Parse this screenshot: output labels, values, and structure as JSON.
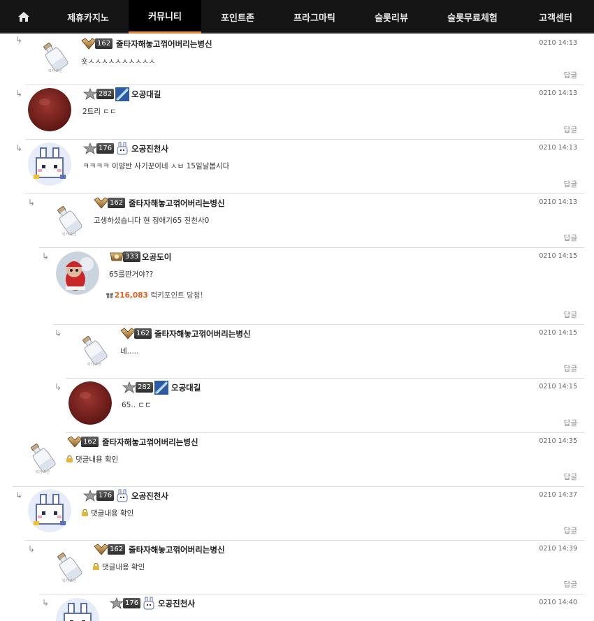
{
  "nav": {
    "home_icon": "home-icon",
    "items": [
      "제휴카지노",
      "커뮤니티",
      "포인트존",
      "프라그마틱",
      "슬롯리뷰",
      "슬롯무료체험",
      "고객센터"
    ],
    "active_index": 1,
    "accent_color": "#e8842e"
  },
  "reply_arrow": "↳",
  "reply_label": "답글",
  "locked_text": "댓글내용 확인",
  "comments": [
    {
      "level": "162",
      "author": "줄타자해놓고꺾어버리는병신",
      "time": "0210 14:13",
      "text": "숏ㅅㅅㅅㅅㅅㅅㅅㅅㅅㅅ",
      "avatar": "bottle-avatar",
      "avatar_caption": "럭키 포션"
    },
    {
      "level": "282",
      "author": "오공대길",
      "time": "0210 14:13",
      "text": "2트리 ㄷㄷ",
      "avatar": "red-circle-avatar"
    },
    {
      "level": "176",
      "author": "오공진천사",
      "time": "0210 14:13",
      "text": "ㅋㅋㅋㅋ 이양반 사기꾼이네 ㅅㅂ 15일날봅시다",
      "avatar": "pixel-bunny-avatar"
    },
    {
      "level": "162",
      "author": "줄타자해놓고꺾어버리는병신",
      "time": "0210 14:13",
      "text": "고생하셨습니다 현 정애기65 진천사0",
      "avatar": "bottle-avatar",
      "avatar_caption": "럭키 포션"
    },
    {
      "level": "333",
      "author": "오공도이",
      "time": "0210 14:15",
      "text": "65를딴거야??",
      "avatar": "santa-avatar",
      "lucky_points": "216,083",
      "lucky_text": "럭키포인트 당첨!"
    },
    {
      "level": "162",
      "author": "줄타자해놓고꺾어버리는병신",
      "time": "0210 14:15",
      "text": "네.....",
      "avatar": "bottle-avatar",
      "avatar_caption": "럭키 포션"
    },
    {
      "level": "282",
      "author": "오공대길",
      "time": "0210 14:15",
      "text": "65.. ㄷㄷ",
      "avatar": "red-circle-avatar"
    },
    {
      "level": "162",
      "author": "줄타자해놓고꺾어버리는병신",
      "time": "0210 14:35",
      "text": "댓글내용 확인",
      "avatar": "bottle-avatar",
      "avatar_caption": "럭키 포션",
      "locked": true
    },
    {
      "level": "176",
      "author": "오공진천사",
      "time": "0210 14:37",
      "text": "댓글내용 확인",
      "avatar": "pixel-bunny-avatar",
      "locked": true
    },
    {
      "level": "162",
      "author": "줄타자해놓고꺾어버리는병신",
      "time": "0210 14:39",
      "text": "댓글내용 확인",
      "avatar": "bottle-avatar",
      "avatar_caption": "럭키 포션",
      "locked": true
    },
    {
      "level": "176",
      "author": "오공진천사",
      "time": "0210 14:40",
      "text": "",
      "avatar": "pixel-bunny-avatar"
    }
  ]
}
